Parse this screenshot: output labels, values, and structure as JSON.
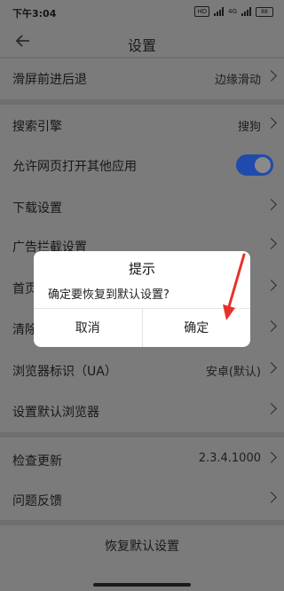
{
  "status_bar": {
    "time": "下午3:04",
    "network": "4G",
    "battery": "88"
  },
  "header": {
    "title": "设置"
  },
  "rows": {
    "swipe": {
      "label": "滑屏前进后退",
      "value": "边缘滑动"
    },
    "search": {
      "label": "搜索引擎",
      "value": "搜狗"
    },
    "open_apps": {
      "label": "允许网页打开其他应用",
      "toggle_on": true
    },
    "download": {
      "label": "下载设置"
    },
    "ad_block": {
      "label": "广告拦截设置"
    },
    "home": {
      "label": "首页"
    },
    "clear": {
      "label": "清除"
    },
    "ua": {
      "label": "浏览器标识（UA）",
      "value": "安卓(默认)"
    },
    "default_browser": {
      "label": "设置默认浏览器"
    },
    "update": {
      "label": "检查更新",
      "value": "2.3.4.1000"
    },
    "feedback": {
      "label": "问题反馈"
    }
  },
  "bottom": {
    "restore_label": "恢复默认设置"
  },
  "dialog": {
    "title": "提示",
    "message": "确定要恢复到默认设置?",
    "cancel_label": "取消",
    "confirm_label": "确定"
  },
  "colors": {
    "toggle_accent": "#1f4cac",
    "annotation_arrow": "#e8312b"
  }
}
